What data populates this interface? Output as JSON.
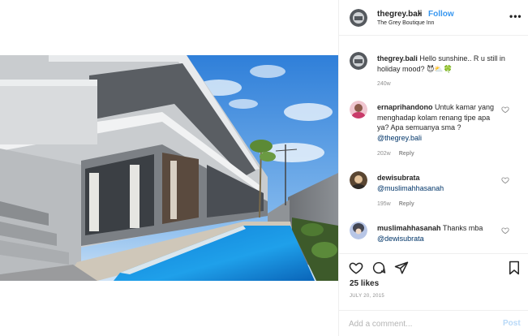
{
  "header": {
    "username": "thegrey.bali",
    "separator": "•",
    "follow_label": "Follow",
    "location": "The Grey Boutique Inn",
    "more_icon": "more-horizontal-icon",
    "more_label": "•••"
  },
  "caption": {
    "username": "thegrey.bali",
    "text": "Hello sunshine.. R u still in holiday mood? ",
    "emoji": "😈⛅🍀",
    "age": "240w"
  },
  "comments": [
    {
      "username": "ernaprihandono",
      "text": "Untuk kamar yang menghadap kolam renang tipe apa ya? Apa semuanya sma ?",
      "mention": "@thegrey.bali",
      "age": "202w",
      "reply_label": "Reply"
    },
    {
      "username": "dewisubrata",
      "text": "",
      "mention": "@muslimahhasanah",
      "age": "195w",
      "reply_label": "Reply"
    },
    {
      "username": "muslimahhasanah",
      "text": "Thanks mba",
      "mention": "@dewisubrata",
      "age": "",
      "reply_label": ""
    }
  ],
  "actions": {
    "like_icon": "heart-icon",
    "comment_icon": "comment-icon",
    "share_icon": "share-icon",
    "save_icon": "bookmark-icon"
  },
  "likes_text": "25 likes",
  "date_text": "JULY 20, 2015",
  "add_comment": {
    "placeholder": "Add a comment...",
    "post_label": "Post"
  },
  "colors": {
    "link_blue": "#3897f0",
    "mention": "#003569",
    "meta_gray": "#8e8e8e",
    "pool": "#1e88d8",
    "sky": "#3f8de0"
  }
}
